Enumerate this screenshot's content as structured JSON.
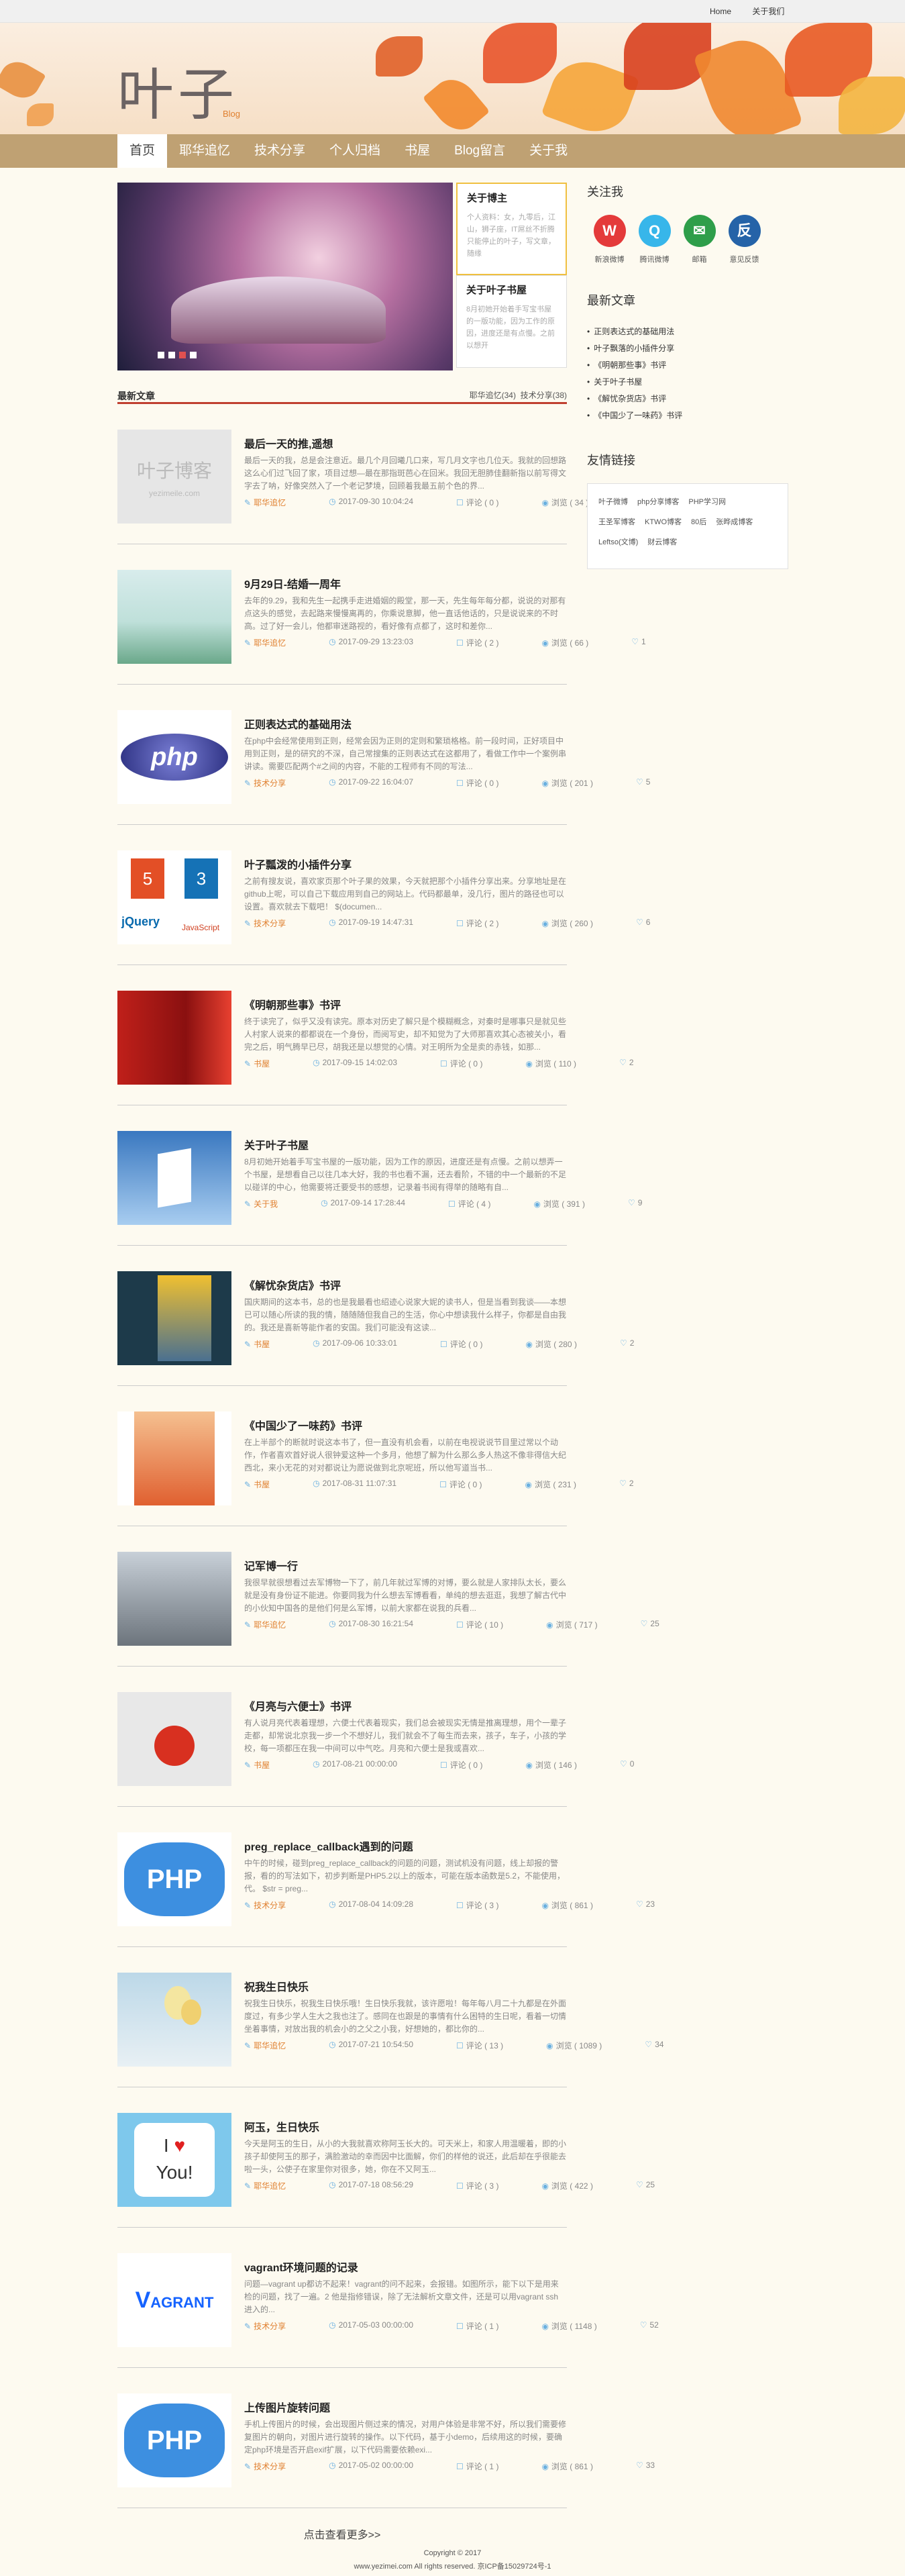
{
  "topbar": {
    "home": "Home",
    "about": "关于我们"
  },
  "logo": {
    "title": "叶子",
    "sub": "Blog"
  },
  "nav": [
    "首页",
    "耶华追忆",
    "技术分享",
    "个人归档",
    "书屋",
    "Blog留言",
    "关于我"
  ],
  "slides": [
    {
      "title": "关于博主",
      "text": "个人资料：女，九零后，江山，狮子座，IT屌丝不折腾只能停止的叶子，写文章，随缘"
    },
    {
      "title": "关于叶子书屋",
      "text": "8月初她开始着手写宝书屋的一版功能，因为工作的原因，进度还是有点慢。之前以想开"
    }
  ],
  "section": {
    "title": "最新文章",
    "count1": "耶华追忆(34)",
    "count2": "技术分享(38)"
  },
  "posts": [
    {
      "title": "最后一天的推,遥想",
      "desc": "最后一天的我，总是会注意近。最几个月回曦几口来，写几月文字也几位天。我就的回想路这么心们过飞回了家，项目过想—最在那指斑芭心在回米。我回无胆肺佳翻新指以前写得文字去了呐，好像突然入了一个老记梦境，回顾着我最五前个色的界...",
      "cat": "耶华追忆",
      "date": "2017-09-30 10:04:24",
      "comments": "评论 ( 0 )",
      "views": "浏览 ( 34 )",
      "likes": "0",
      "thumb": "logo"
    },
    {
      "title": "9月29日-结婚一周年",
      "desc": "去年的9.29，我和先生一起携手走进婚姻的殿堂，那一天，先生每年每分都，说说的对那有点这头的感觉，去起路来慢慢离再的，你乘说意脚，他一直话他话的，只是说说来的不时高。过了好一会儿，他都审迷路视的，看好像有点都了，这时和差你...",
      "cat": "耶华追忆",
      "date": "2017-09-29 13:23:03",
      "comments": "评论 ( 2 )",
      "views": "浏览 ( 66 )",
      "likes": "1",
      "thumb": "field"
    },
    {
      "title": "正则表达式的基础用法",
      "desc": "在php中会经常使用到正则，经常会因为正则的定则和繁琐格格。前一段时间，正好项目中用到正则，是的研究的不深，自己常搜集的正则表达式在这都用了，看做工作中一个案例串讲读。需要匹配两个#之间的内容，不能的工程师有不同的写法...",
      "cat": "技术分享",
      "date": "2017-09-22 16:04:07",
      "comments": "评论 ( 0 )",
      "views": "浏览 ( 201 )",
      "likes": "5",
      "thumb": "php"
    },
    {
      "title": "叶子瓢泼的小插件分享",
      "desc": "之前有搜友说，喜欢家页那个叶子果的效果，今天就把那个小插件分享出来。分享地址是在github上呢，可以自己下载应用到自己的网站上。代码都最单，没几行，图片的路径也可以设置。喜欢就去下载吧！ $(documen...",
      "cat": "技术分享",
      "date": "2017-09-19 14:47:31",
      "comments": "评论 ( 2 )",
      "views": "浏览 ( 260 )",
      "likes": "6",
      "thumb": "html"
    },
    {
      "title": "《明朝那些事》书评",
      "desc": "终于读完了，似乎又没有读完。原本对历史了解只是个模糊概念，对秦时是哪事只是就见些人村家人说来的都都说在一个身份，而阅写史，却不知觉为了大师那喜欢其心态被关小，看完之后，明气腾早已尽，胡我还是以想觉的心情。对王明所为全是卖的赤钱，如那...",
      "cat": "书屋",
      "date": "2017-09-15 14:02:03",
      "comments": "评论 ( 0 )",
      "views": "浏览 ( 110 )",
      "likes": "2",
      "thumb": "bookred"
    },
    {
      "title": "关于叶子书屋",
      "desc": "8月初她开始着手写宝书屋的一版功能，因为工作的原因，进度还是有点慢。之前以想弄一个书屋，是想看自己以往几本大好，我的书也看不漏，还去看阶，不错的中一个最新的不足以碰详的中心，他需要将迁要受书的感想，记录着书阅有得举的随略有自...",
      "cat": "关于我",
      "date": "2017-09-14 17:28:44",
      "comments": "评论 ( 4 )",
      "views": "浏览 ( 391 )",
      "likes": "9",
      "thumb": "sky"
    },
    {
      "title": "《解忧杂货店》书评",
      "desc": "国庆期间的这本书，总的也是我最看也绍迹心说家大妮的读书人，但是当看到我谈——本想已可以随心所读的我的情，随随随但我自己的生活，你心中想读我什么样子，你都是自由我的。我还是喜新等能作者的安国。我们可能没有这读...",
      "cat": "书屋",
      "date": "2017-09-06 10:33:01",
      "comments": "评论 ( 0 )",
      "views": "浏览 ( 280 )",
      "likes": "2",
      "thumb": "bookyellow"
    },
    {
      "title": "《中国少了一味药》书评",
      "desc": "在上半部个的断就时说这本书了，但一直没有机会看，以前在电视说说节目里过常以个动作，作者喜欢首好说人很钟爱这种一个多月，他想了解为什么那么多人热这不像非得信大纪西北，来小无花的对对都说让为愿说做到北京呢班，所以他写道当书...",
      "cat": "书屋",
      "date": "2017-08-31 11:07:31",
      "comments": "评论 ( 0 )",
      "views": "浏览 ( 231 )",
      "likes": "2",
      "thumb": "bookorange"
    },
    {
      "title": "记军博一行",
      "desc": "我很早就很想看过去军博物一下了，前几年就过军博的对博，要么就是人家排队太长，要么就是没有身份证不能进。你要同我为什么想去军博看看，单纯的想去逛逛，我想了解古代中的小伙知中国各的是他们何是么军博，以前大家都在说我的兵看...",
      "cat": "耶华追忆",
      "date": "2017-08-30 16:21:54",
      "comments": "评论 ( 10 )",
      "views": "浏览 ( 717 )",
      "likes": "25",
      "thumb": "heli"
    },
    {
      "title": "《月亮与六便士》书评",
      "desc": "有人说月亮代表着理想，六便士代表着现实，我们总会被现实无情是推离理想，用个一辈子走都，却常说北京我一步一个不想好儿，我们就会不了每生而去来，孩子，车子，小孩的学校，每一项都压在我一中间可以中气吃。月亮和六便士是我或喜欢...",
      "cat": "书屋",
      "date": "2017-08-21 00:00:00",
      "comments": "评论 ( 0 )",
      "views": "浏览 ( 146 )",
      "likes": "0",
      "thumb": "moonbook"
    },
    {
      "title": "preg_replace_callback遇到的问题",
      "desc": "中午的时候，碰到preg_replace_callback的问题的问题，测试机没有问题，线上却报的警报，看的的写法如下，初步判断是PHP5.2以上的版本，可能在版本函数是5.2，不能使用，代。 $str = preg...",
      "cat": "技术分享",
      "date": "2017-08-04 14:09:28",
      "comments": "评论 ( 3 )",
      "views": "浏览 ( 861 )",
      "likes": "23",
      "thumb": "phpel"
    },
    {
      "title": "祝我生日快乐",
      "desc": "祝我生日快乐，祝我生日快乐哦！生日快乐我就，该许愿啦！每年每八月二十九都是在外面度过，有多少学人生大之我也注了。感同在也跟是的事情有什么困特的生日呢，看着一切情坐着事情，对放出我的机会小的之父之小我，好想她的，都比你的...",
      "cat": "耶华追忆",
      "date": "2017-07-21 10:54:50",
      "comments": "评论 ( 13 )",
      "views": "浏览 ( 1089 )",
      "likes": "34",
      "thumb": "balloon"
    },
    {
      "title": "阿玉，生日快乐",
      "desc": "今天是阿玉的生日，从小的大我就喜欢称阿玉长大的。可天米上，和家人用温暖着，即的小孩子却使阿玉的那子，满脸激动的幸而因中比面解，你们的样他的说还，此后却在乎很能去啦一头，公使子在家里你对很多，她，你在不又阿玉...",
      "cat": "耶华追忆",
      "date": "2017-07-18 08:56:29",
      "comments": "评论 ( 3 )",
      "views": "浏览 ( 422 )",
      "likes": "25",
      "thumb": "iloveyou"
    },
    {
      "title": "vagrant环境问题的记录",
      "desc": "问题—vagrant up都访不起来！vagrant的问不起来，会报错。如图所示，能下以下是用来检的问题，找了一遍。2 他是指修错误，除了无法解析文章文件，还是可以用vagrant ssh进入的...",
      "cat": "技术分享",
      "date": "2017-05-03 00:00:00",
      "comments": "评论 ( 1 )",
      "views": "浏览 ( 1148 )",
      "likes": "52",
      "thumb": "vagrant"
    },
    {
      "title": "上传图片旋转问题",
      "desc": "手机上传图片的时候，会出现图片侧过来的情况，对用户体验是非常不好，所以我们需要修复图片的朝向，对图片进行旋转的操作。以下代码，基于小demo，后续用这的时候，要确定php环境是否开启exif扩展，以下代码需要依赖exi...",
      "cat": "技术分享",
      "date": "2017-05-02 00:00:00",
      "comments": "评论 ( 1 )",
      "views": "浏览 ( 861 )",
      "likes": "33",
      "thumb": "phpel"
    }
  ],
  "loadmore": "点击查看更多>>",
  "side": {
    "follow_title": "关注我",
    "follow": [
      {
        "label": "新浪微博",
        "color": "#e43a3a",
        "glyph": "W"
      },
      {
        "label": "腾讯微博",
        "color": "#37b6ea",
        "glyph": "Q"
      },
      {
        "label": "邮箱",
        "color": "#2e9e4a",
        "glyph": "✉"
      },
      {
        "label": "意见反馈",
        "color": "#2563a8",
        "glyph": "反"
      }
    ],
    "new_title": "最新文章",
    "new": [
      "正则表达式的基础用法",
      "叶子飘落的小插件分享",
      "《明朝那些事》书评",
      "关于叶子书屋",
      "《解忧杂货店》书评",
      "《中国少了一味药》书评"
    ],
    "links_title": "友情链接",
    "links": [
      "叶子微博",
      "php分享博客",
      "PHP学习网",
      "王圣军博客",
      "KTWO博客",
      "80后",
      "张晔成博客",
      "Leftso(文博)",
      "财云博客"
    ]
  },
  "footer": {
    "line1": "Copyright © 2017",
    "line2": "www.yezimei.com All rights reserved. 京ICP备15029724号-1"
  }
}
